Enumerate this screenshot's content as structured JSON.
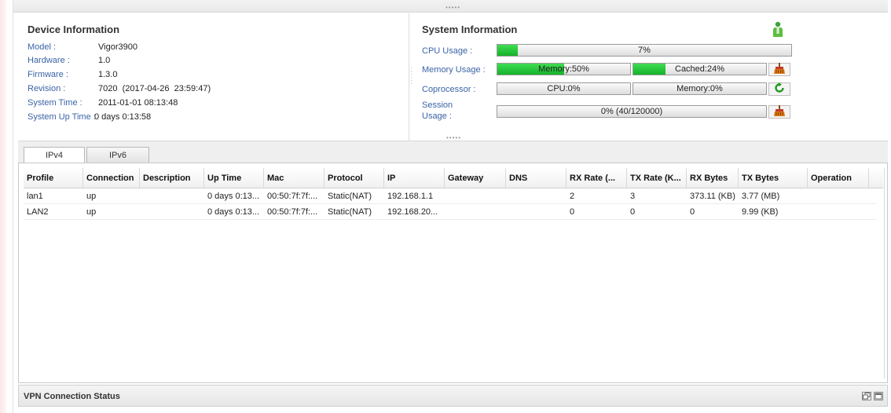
{
  "device_info": {
    "title": "Device Information",
    "rows": [
      {
        "label": "Model :",
        "value": "Vigor3900"
      },
      {
        "label": "Hardware :",
        "value": "1.0"
      },
      {
        "label": "Firmware :",
        "value": "1.3.0"
      },
      {
        "label": "Revision :",
        "value": "7020  (2017-04-26  23:59:47)"
      },
      {
        "label": "System Time :",
        "value": "2011-01-01 08:13:48"
      }
    ],
    "uptime": {
      "label": "System Up Time :",
      "value": "0 days 0:13:58"
    }
  },
  "system_info": {
    "title": "System Information",
    "cpu": {
      "label": "CPU Usage :",
      "text": "7%",
      "level": 0.07
    },
    "memory": {
      "label": "Memory Usage :",
      "memory_text": "Memory:50%",
      "memory_level": 0.5,
      "cached_text": "Cached:24%",
      "cached_level": 0.24
    },
    "coprocessor": {
      "label": "Coprocessor :",
      "cpu_text": "CPU:0%",
      "memory_text": "Memory:0%"
    },
    "session": {
      "label_line1": "Session",
      "label_line2": "Usage :",
      "text": "0% (40/120000)",
      "level": 0.0
    }
  },
  "tabs": [
    {
      "label": "IPv4"
    },
    {
      "label": "IPv6"
    }
  ],
  "table": {
    "columns": [
      "Profile",
      "Connection",
      "Description",
      "Up Time",
      "Mac",
      "Protocol",
      "IP",
      "Gateway",
      "DNS",
      "RX Rate (...",
      "TX Rate (K...",
      "RX Bytes",
      "TX Bytes",
      "Operation"
    ],
    "rows": [
      [
        "lan1",
        "up",
        "",
        "0 days 0:13...",
        "00:50:7f:7f:...",
        "Static(NAT)",
        "192.168.1.1",
        "",
        "",
        "2",
        "3",
        "373.11 (KB)",
        "3.77 (MB)",
        ""
      ],
      [
        "LAN2",
        "up",
        "",
        "0 days 0:13...",
        "00:50:7f:7f:...",
        "Static(NAT)",
        "192.168.20...",
        "",
        "",
        "0",
        "0",
        "0",
        "9.99 (KB)",
        ""
      ]
    ]
  },
  "vpn": {
    "title": "VPN Connection Status"
  },
  "colors": {
    "label_blue": "#3b63a6",
    "bar_green": "#22c036",
    "icon_orange": "#e07a10"
  },
  "icons": [
    "user-icon",
    "broom-icon",
    "refresh-icon",
    "restore-window-icon",
    "maximize-window-icon"
  ]
}
